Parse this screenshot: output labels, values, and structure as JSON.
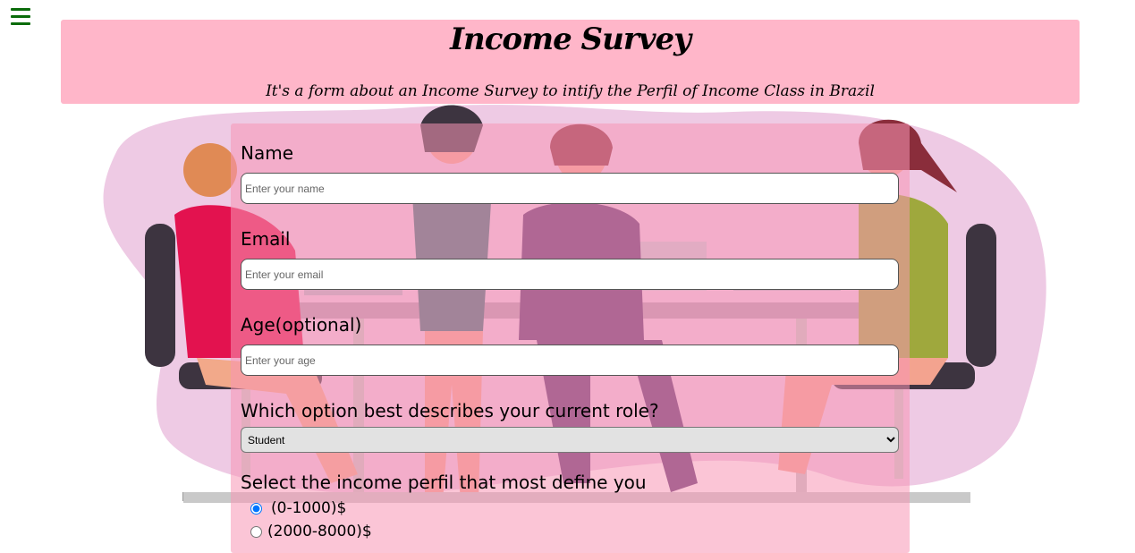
{
  "header": {
    "title": "Income Survey",
    "subtitle": "It's a form about an Income Survey to intify the Perfil of Income Class in Brazil"
  },
  "form": {
    "name": {
      "label": "Name",
      "placeholder": "Enter your name"
    },
    "email": {
      "label": "Email",
      "placeholder": "Enter your email"
    },
    "age": {
      "label": "Age(optional)",
      "placeholder": "Enter your age"
    },
    "role": {
      "label": "Which option best describes your current role?",
      "selected": "Student"
    },
    "income": {
      "label": "Select the income perfil that most define you",
      "options": [
        {
          "label": "(0-1000)$",
          "checked": true
        },
        {
          "label": "(2000-8000)$",
          "checked": false
        }
      ]
    }
  },
  "colors": {
    "header_bg": "#ffb6c9",
    "menu_icon": "#0a6b0a",
    "radio_accent": "#1a5fd6"
  }
}
